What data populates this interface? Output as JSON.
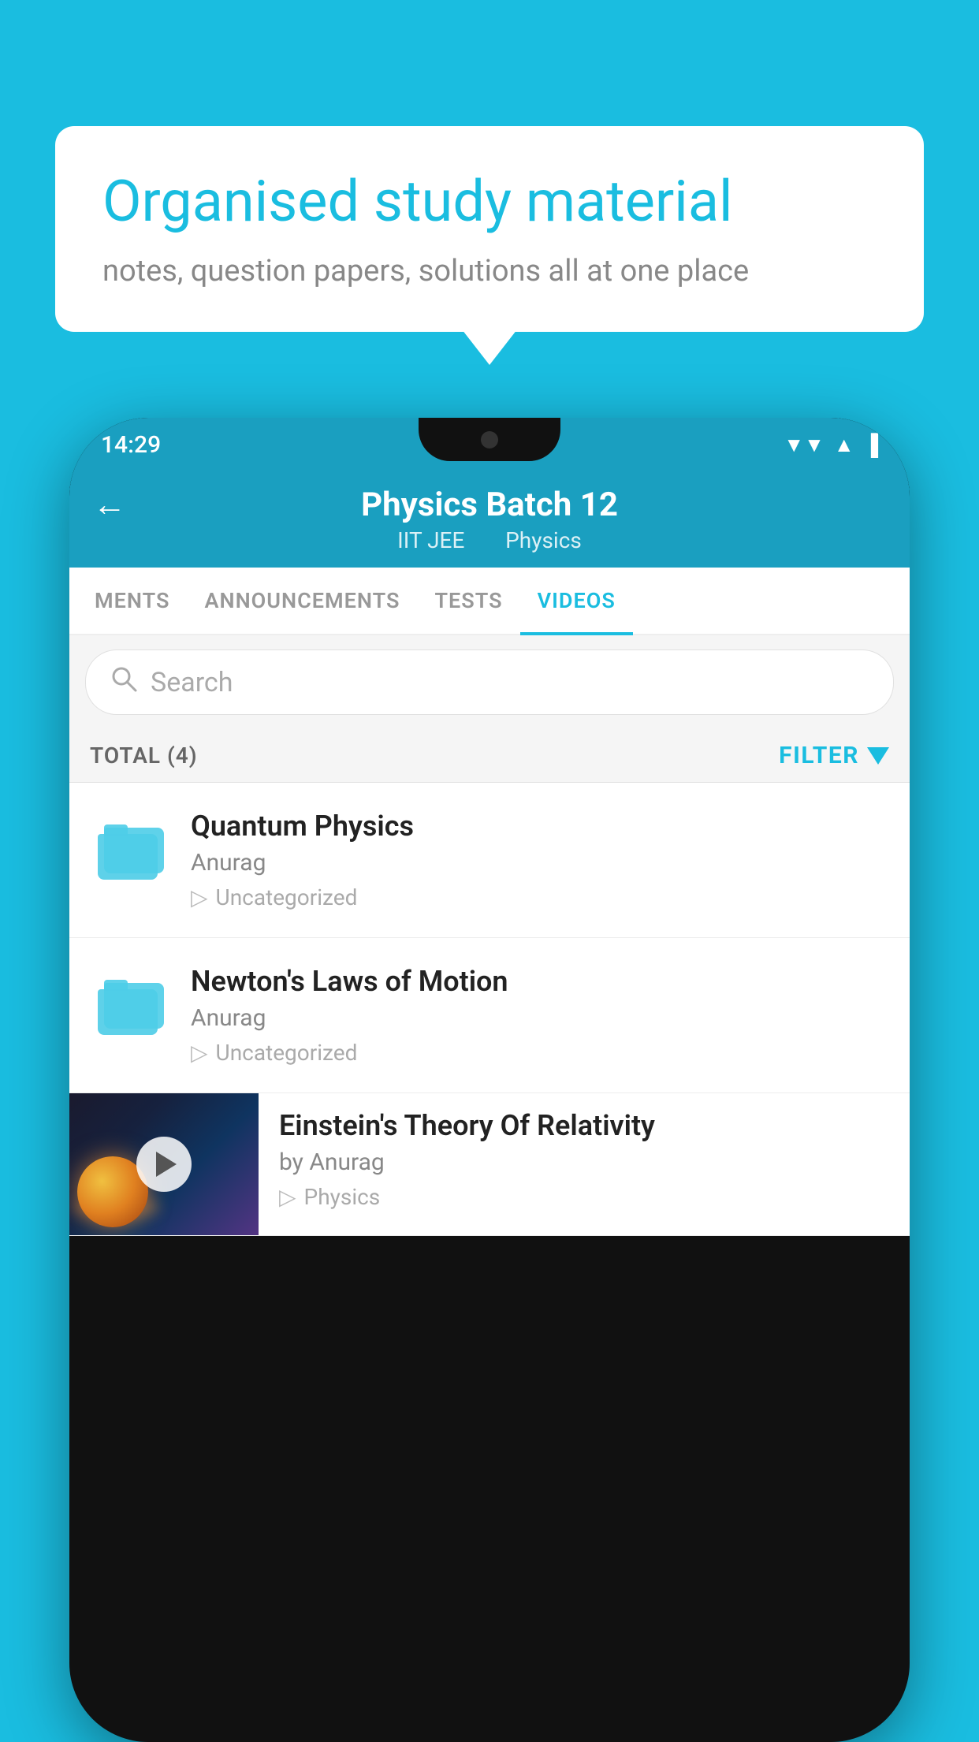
{
  "background": {
    "color": "#1ABDE0"
  },
  "speech_bubble": {
    "title": "Organised study material",
    "subtitle": "notes, question papers, solutions all at one place"
  },
  "phone": {
    "status_bar": {
      "time": "14:29",
      "wifi": "▼",
      "signal": "▲",
      "battery": "▮"
    },
    "header": {
      "title": "Physics Batch 12",
      "subtitle_left": "IIT JEE",
      "subtitle_right": "Physics",
      "back_label": "←"
    },
    "tabs": [
      {
        "label": "MENTS",
        "active": false
      },
      {
        "label": "ANNOUNCEMENTS",
        "active": false
      },
      {
        "label": "TESTS",
        "active": false
      },
      {
        "label": "VIDEOS",
        "active": true
      }
    ],
    "search": {
      "placeholder": "Search"
    },
    "filter": {
      "total_label": "TOTAL (4)",
      "filter_label": "FILTER"
    },
    "videos": [
      {
        "id": 1,
        "title": "Quantum Physics",
        "author": "Anurag",
        "tag": "Uncategorized",
        "has_thumbnail": false
      },
      {
        "id": 2,
        "title": "Newton's Laws of Motion",
        "author": "Anurag",
        "tag": "Uncategorized",
        "has_thumbnail": false
      },
      {
        "id": 3,
        "title": "Einstein's Theory Of Relativity",
        "author": "by Anurag",
        "tag": "Physics",
        "has_thumbnail": true
      }
    ]
  }
}
